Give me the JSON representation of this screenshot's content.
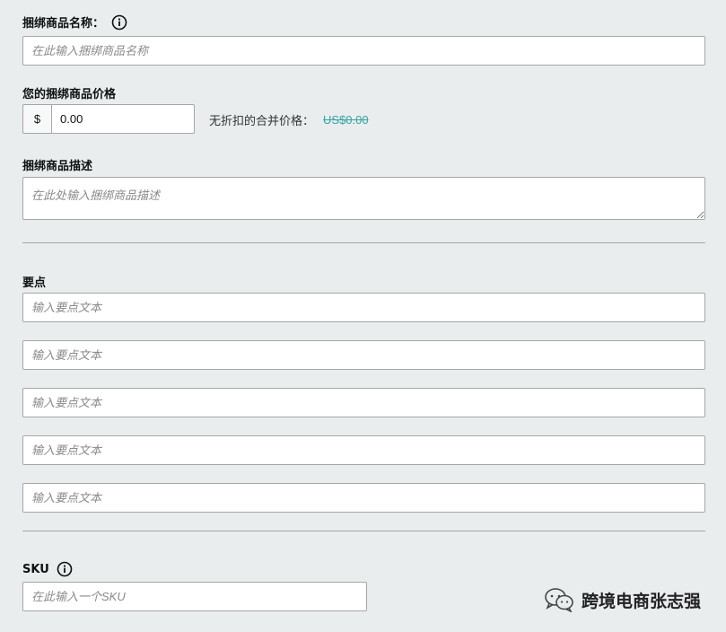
{
  "bundle_name": {
    "label": "捆绑商品名称：",
    "placeholder": "在此输入捆绑商品名称",
    "icon": "info-icon"
  },
  "bundle_price": {
    "label": "您的捆绑商品价格",
    "currency_symbol": "$",
    "value": "0.00",
    "combined_label": "无折扣的合并价格：",
    "combined_price": "US$0.00"
  },
  "bundle_description": {
    "label": "捆绑商品描述",
    "placeholder": "在此处输入捆绑商品描述"
  },
  "bullet_points": {
    "label": "要点",
    "items": [
      {
        "placeholder": "输入要点文本"
      },
      {
        "placeholder": "输入要点文本"
      },
      {
        "placeholder": "输入要点文本"
      },
      {
        "placeholder": "输入要点文本"
      },
      {
        "placeholder": "输入要点文本"
      }
    ]
  },
  "sku": {
    "label": "SKU",
    "placeholder": "在此输入一个SKU",
    "icon": "info-icon"
  },
  "watermark": {
    "text": "跨境电商张志强",
    "icon": "wechat-icon"
  },
  "colors": {
    "background": "#e9edee",
    "border": "#a6a6a6",
    "struck_price": "#3aa3a3"
  }
}
